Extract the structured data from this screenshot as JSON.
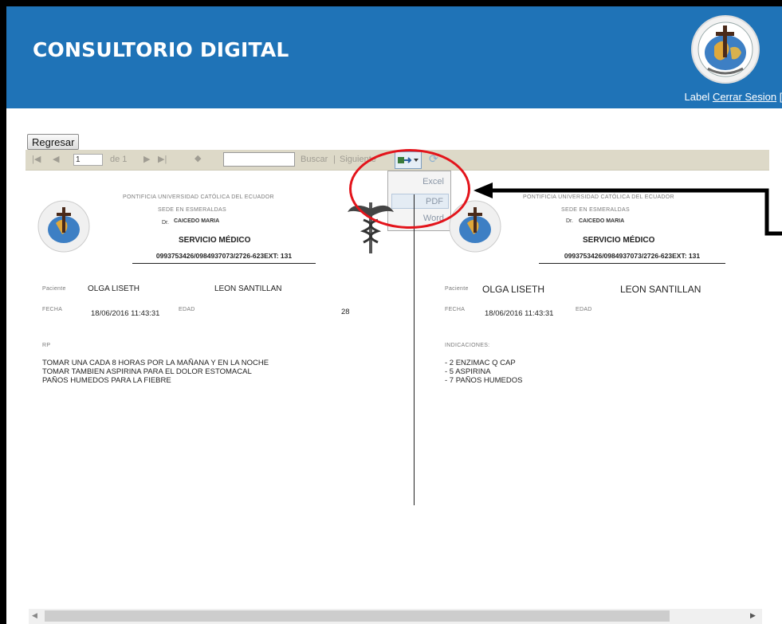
{
  "header": {
    "title": "CONSULTORIO DIGITAL",
    "session_label": "Label",
    "logout_link": "Cerrar Sesion",
    "brackets": "[]",
    "logo_icon": "university-seal-icon"
  },
  "back_button": "Regresar",
  "toolbar": {
    "current_page": "1",
    "of_pages": "de 1",
    "search_link": "Buscar",
    "separator": "|",
    "next_link": "Siguiente"
  },
  "export_menu": {
    "items": [
      "Excel",
      "PDF",
      "Word"
    ],
    "highlighted": "PDF"
  },
  "report": {
    "university": "PONTIFICIA UNIVERSIDAD CATÓLICA DEL ECUADOR",
    "campus": "SEDE EN ESMERALDAS",
    "doctor_prefix": "Dr.",
    "doctor_name": "CAICEDO MARIA",
    "service": "SERVICIO MÉDICO",
    "phones": "0993753426/0984937073/2726-623EXT: 131",
    "patient_label": "Paciente",
    "patient_first": "OLGA LISETH",
    "patient_last": "LEON SANTILLAN",
    "date_label": "FECHA",
    "date_value": "18/06/2016 11:43:31",
    "age_label": "EDAD",
    "age_value": "28",
    "rx_label": "RP",
    "rx_lines": [
      "TOMAR UNA CADA 8 HORAS POR LA MAÑANA Y EN LA NOCHE",
      "TOMAR TAMBIEN ASPIRINA PARA EL DOLOR ESTOMACAL",
      "PAÑOS HUMEDOS PARA LA FIEBRE"
    ],
    "indications_label": "INDICACIONES:",
    "indications": [
      "- 2 ENZIMAC Q CAP",
      "- 5 ASPIRINA",
      "- 7 PAÑOS HUMEDOS"
    ]
  },
  "colors": {
    "header_bg": "#1f73b7",
    "toolbar_bg": "#ddd9c8",
    "annotation": "#e3141b"
  }
}
